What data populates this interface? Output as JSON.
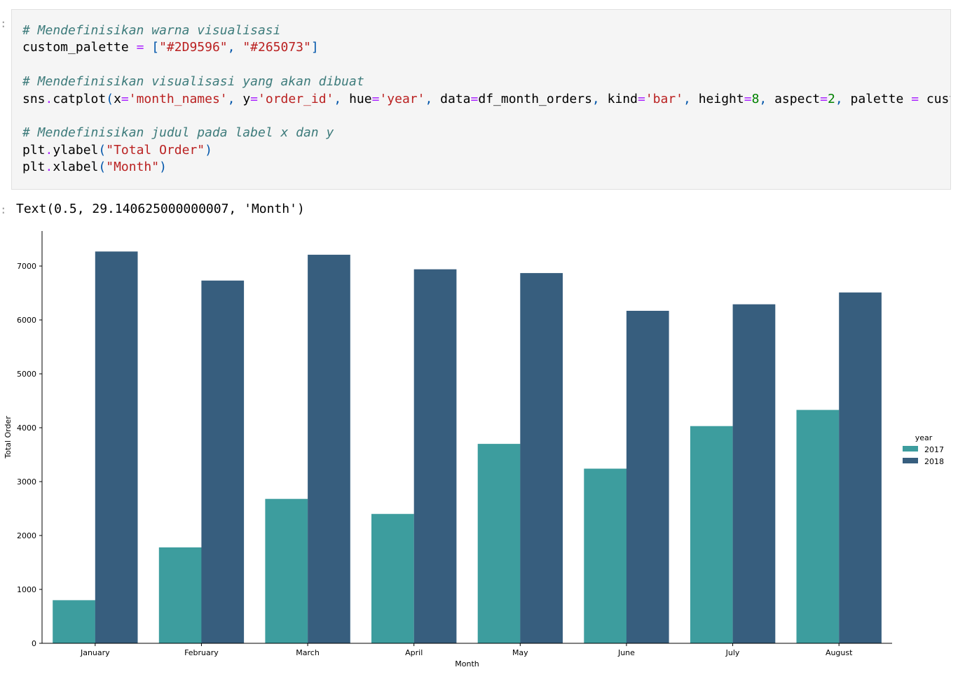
{
  "notebook": {
    "input_prompt": ":",
    "output_prompt": ":",
    "code_lines": [
      [
        {
          "t": "comment",
          "v": "# Mendefinisikan warna visualisasi"
        }
      ],
      [
        {
          "t": "plain",
          "v": "custom_palette "
        },
        {
          "t": "op",
          "v": "="
        },
        {
          "t": "plain",
          "v": " "
        },
        {
          "t": "punct",
          "v": "["
        },
        {
          "t": "str",
          "v": "\"#2D9596\""
        },
        {
          "t": "punct",
          "v": ", "
        },
        {
          "t": "str",
          "v": "\"#265073\""
        },
        {
          "t": "punct",
          "v": "]"
        }
      ],
      [],
      [
        {
          "t": "comment",
          "v": "# Mendefinisikan visualisasi yang akan dibuat"
        }
      ],
      [
        {
          "t": "plain",
          "v": "sns"
        },
        {
          "t": "op",
          "v": "."
        },
        {
          "t": "plain",
          "v": "catplot"
        },
        {
          "t": "punct",
          "v": "("
        },
        {
          "t": "plain",
          "v": "x"
        },
        {
          "t": "op",
          "v": "="
        },
        {
          "t": "str",
          "v": "'month_names'"
        },
        {
          "t": "punct",
          "v": ", "
        },
        {
          "t": "plain",
          "v": "y"
        },
        {
          "t": "op",
          "v": "="
        },
        {
          "t": "str",
          "v": "'order_id'"
        },
        {
          "t": "punct",
          "v": ", "
        },
        {
          "t": "plain",
          "v": "hue"
        },
        {
          "t": "op",
          "v": "="
        },
        {
          "t": "str",
          "v": "'year'"
        },
        {
          "t": "punct",
          "v": ", "
        },
        {
          "t": "plain",
          "v": "data"
        },
        {
          "t": "op",
          "v": "="
        },
        {
          "t": "plain",
          "v": "df_month_orders"
        },
        {
          "t": "punct",
          "v": ", "
        },
        {
          "t": "plain",
          "v": "kind"
        },
        {
          "t": "op",
          "v": "="
        },
        {
          "t": "str",
          "v": "'bar'"
        },
        {
          "t": "punct",
          "v": ", "
        },
        {
          "t": "plain",
          "v": "height"
        },
        {
          "t": "op",
          "v": "="
        },
        {
          "t": "num",
          "v": "8"
        },
        {
          "t": "punct",
          "v": ", "
        },
        {
          "t": "plain",
          "v": "aspect"
        },
        {
          "t": "op",
          "v": "="
        },
        {
          "t": "num",
          "v": "2"
        },
        {
          "t": "punct",
          "v": ", "
        },
        {
          "t": "plain",
          "v": "palette "
        },
        {
          "t": "op",
          "v": "="
        },
        {
          "t": "plain",
          "v": " custom_palette"
        },
        {
          "t": "punct",
          "v": ")"
        }
      ],
      [],
      [
        {
          "t": "comment",
          "v": "# Mendefinisikan judul pada label x dan y"
        }
      ],
      [
        {
          "t": "plain",
          "v": "plt"
        },
        {
          "t": "op",
          "v": "."
        },
        {
          "t": "plain",
          "v": "ylabel"
        },
        {
          "t": "punct",
          "v": "("
        },
        {
          "t": "str",
          "v": "\"Total Order\""
        },
        {
          "t": "punct",
          "v": ")"
        }
      ],
      [
        {
          "t": "plain",
          "v": "plt"
        },
        {
          "t": "op",
          "v": "."
        },
        {
          "t": "plain",
          "v": "xlabel"
        },
        {
          "t": "punct",
          "v": "("
        },
        {
          "t": "str",
          "v": "\"Month\""
        },
        {
          "t": "punct",
          "v": ")"
        }
      ]
    ],
    "output_text": "Text(0.5, 29.140625000000007, 'Month')"
  },
  "chart_data": {
    "type": "bar",
    "title": "",
    "xlabel": "Month",
    "ylabel": "Total Order",
    "categories": [
      "January",
      "February",
      "March",
      "April",
      "May",
      "June",
      "July",
      "August"
    ],
    "ylim": [
      0,
      7650
    ],
    "yticks": [
      0,
      1000,
      2000,
      3000,
      4000,
      5000,
      6000,
      7000
    ],
    "legend_title": "year",
    "legend_position": "center-right",
    "grid": false,
    "series": [
      {
        "name": "2017",
        "color": "#2D9596",
        "values": [
          800,
          1780,
          2680,
          2400,
          3700,
          3240,
          4030,
          4330
        ]
      },
      {
        "name": "2018",
        "color": "#265073",
        "values": [
          7270,
          6730,
          7210,
          6940,
          6870,
          6170,
          6290,
          6510
        ]
      }
    ]
  }
}
